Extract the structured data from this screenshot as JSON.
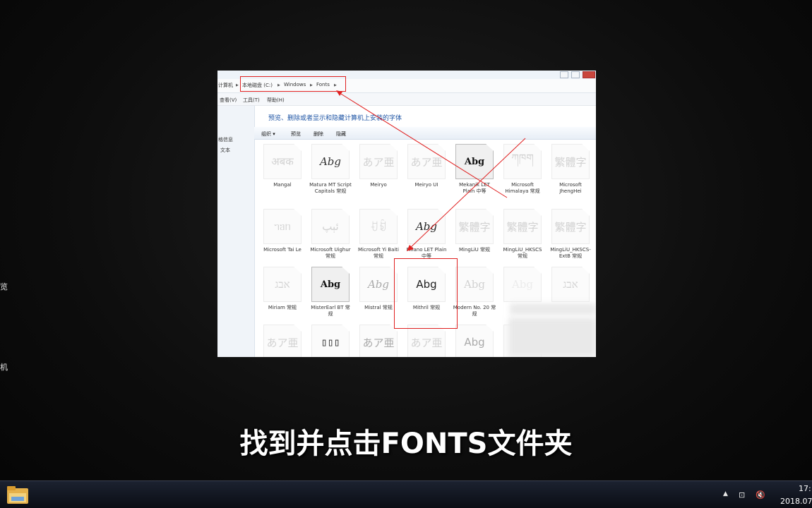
{
  "edge_glyphs": [
    "览",
    "机"
  ],
  "screenshot": {
    "breadcrumb": [
      "计算机",
      "本地磁盘 (C:)",
      "Windows",
      "Fonts"
    ],
    "menu": [
      "查看(V)",
      "工具(T)",
      "帮助(H)"
    ],
    "nav": [
      "格信息",
      "文本"
    ],
    "heading": "预览、删除或者显示和隐藏计算机上安装的字体",
    "toolbar": [
      "组织 ▾",
      "预览",
      "删除",
      "隐藏"
    ],
    "fonts": [
      {
        "name": "Mangal",
        "preview": "अबक"
      },
      {
        "name": "Matura MT Script Capitals 常规",
        "preview": "Abg"
      },
      {
        "name": "Meiryo",
        "preview": "あア亜"
      },
      {
        "name": "Meiryo UI",
        "preview": "あア亜"
      },
      {
        "name": "Mekanik LET Plain 中等",
        "preview": "Abg"
      },
      {
        "name": "Microsoft Himalaya 常规",
        "preview": "ཀཁག"
      },
      {
        "name": "Microsoft JhengHei",
        "preview": "繁體字"
      },
      {
        "name": "Microsoft Tai Le",
        "preview": "ᥐᥑᥒ"
      },
      {
        "name": "Microsoft Uighur 常规",
        "preview": "ئېپ"
      },
      {
        "name": "Microsoft Yi Baiti 常规",
        "preview": "ꀀꀁ"
      },
      {
        "name": "Milano LET Plain 中等",
        "preview": "Abg"
      },
      {
        "name": "MingLiU 常规",
        "preview": "繁體字"
      },
      {
        "name": "MingLiU_HKSCS 常规",
        "preview": "繁體字"
      },
      {
        "name": "MingLiU_HKSCS-ExtB 常规",
        "preview": "繁體字"
      },
      {
        "name": "Miriam 常规",
        "preview": "אבג"
      },
      {
        "name": "MisterEarl BT 常规",
        "preview": "Abg"
      },
      {
        "name": "Mistral 常规",
        "preview": "Abg"
      },
      {
        "name": "Mithril 常规",
        "preview": "Abg"
      },
      {
        "name": "Modern No. 20 常规",
        "preview": "Abg"
      },
      {
        "name": "",
        "preview": "Abg"
      },
      {
        "name": "",
        "preview": "אבג"
      },
      {
        "name": "",
        "preview": "あア亜"
      },
      {
        "name": "",
        "preview": "▯▯▯"
      },
      {
        "name": "",
        "preview": "あア亜"
      },
      {
        "name": "",
        "preview": "あア亜"
      },
      {
        "name": "",
        "preview": "Abg"
      }
    ]
  },
  "subtitle": "找到并点击FONTS文件夹",
  "taskbar": {
    "clock_time": "17:",
    "clock_date": "2018.07"
  },
  "colors": {
    "highlight": "#e02020",
    "link_blue": "#1f55a5"
  }
}
